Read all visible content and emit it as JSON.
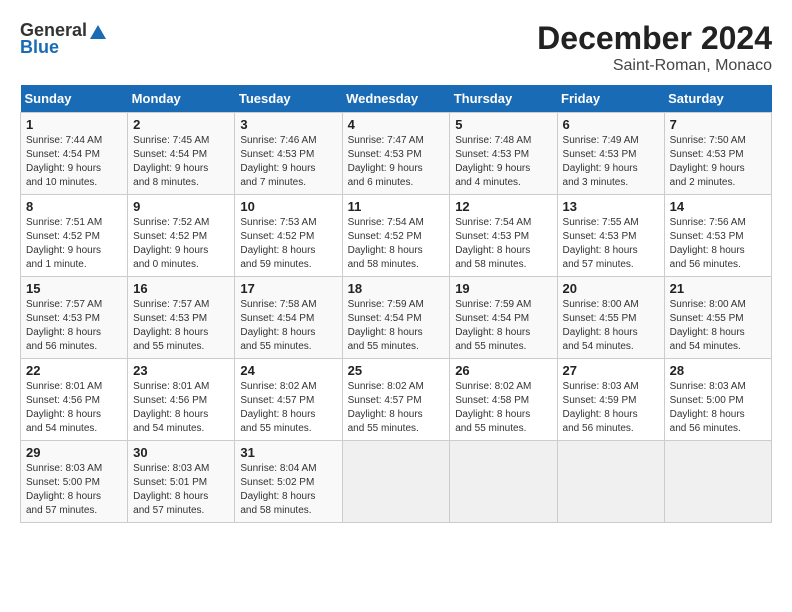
{
  "header": {
    "logo_general": "General",
    "logo_blue": "Blue",
    "month": "December 2024",
    "location": "Saint-Roman, Monaco"
  },
  "weekdays": [
    "Sunday",
    "Monday",
    "Tuesday",
    "Wednesday",
    "Thursday",
    "Friday",
    "Saturday"
  ],
  "weeks": [
    [
      {
        "day": "1",
        "info": "Sunrise: 7:44 AM\nSunset: 4:54 PM\nDaylight: 9 hours\nand 10 minutes."
      },
      {
        "day": "2",
        "info": "Sunrise: 7:45 AM\nSunset: 4:54 PM\nDaylight: 9 hours\nand 8 minutes."
      },
      {
        "day": "3",
        "info": "Sunrise: 7:46 AM\nSunset: 4:53 PM\nDaylight: 9 hours\nand 7 minutes."
      },
      {
        "day": "4",
        "info": "Sunrise: 7:47 AM\nSunset: 4:53 PM\nDaylight: 9 hours\nand 6 minutes."
      },
      {
        "day": "5",
        "info": "Sunrise: 7:48 AM\nSunset: 4:53 PM\nDaylight: 9 hours\nand 4 minutes."
      },
      {
        "day": "6",
        "info": "Sunrise: 7:49 AM\nSunset: 4:53 PM\nDaylight: 9 hours\nand 3 minutes."
      },
      {
        "day": "7",
        "info": "Sunrise: 7:50 AM\nSunset: 4:53 PM\nDaylight: 9 hours\nand 2 minutes."
      }
    ],
    [
      {
        "day": "8",
        "info": "Sunrise: 7:51 AM\nSunset: 4:52 PM\nDaylight: 9 hours\nand 1 minute."
      },
      {
        "day": "9",
        "info": "Sunrise: 7:52 AM\nSunset: 4:52 PM\nDaylight: 9 hours\nand 0 minutes."
      },
      {
        "day": "10",
        "info": "Sunrise: 7:53 AM\nSunset: 4:52 PM\nDaylight: 8 hours\nand 59 minutes."
      },
      {
        "day": "11",
        "info": "Sunrise: 7:54 AM\nSunset: 4:52 PM\nDaylight: 8 hours\nand 58 minutes."
      },
      {
        "day": "12",
        "info": "Sunrise: 7:54 AM\nSunset: 4:53 PM\nDaylight: 8 hours\nand 58 minutes."
      },
      {
        "day": "13",
        "info": "Sunrise: 7:55 AM\nSunset: 4:53 PM\nDaylight: 8 hours\nand 57 minutes."
      },
      {
        "day": "14",
        "info": "Sunrise: 7:56 AM\nSunset: 4:53 PM\nDaylight: 8 hours\nand 56 minutes."
      }
    ],
    [
      {
        "day": "15",
        "info": "Sunrise: 7:57 AM\nSunset: 4:53 PM\nDaylight: 8 hours\nand 56 minutes."
      },
      {
        "day": "16",
        "info": "Sunrise: 7:57 AM\nSunset: 4:53 PM\nDaylight: 8 hours\nand 55 minutes."
      },
      {
        "day": "17",
        "info": "Sunrise: 7:58 AM\nSunset: 4:54 PM\nDaylight: 8 hours\nand 55 minutes."
      },
      {
        "day": "18",
        "info": "Sunrise: 7:59 AM\nSunset: 4:54 PM\nDaylight: 8 hours\nand 55 minutes."
      },
      {
        "day": "19",
        "info": "Sunrise: 7:59 AM\nSunset: 4:54 PM\nDaylight: 8 hours\nand 55 minutes."
      },
      {
        "day": "20",
        "info": "Sunrise: 8:00 AM\nSunset: 4:55 PM\nDaylight: 8 hours\nand 54 minutes."
      },
      {
        "day": "21",
        "info": "Sunrise: 8:00 AM\nSunset: 4:55 PM\nDaylight: 8 hours\nand 54 minutes."
      }
    ],
    [
      {
        "day": "22",
        "info": "Sunrise: 8:01 AM\nSunset: 4:56 PM\nDaylight: 8 hours\nand 54 minutes."
      },
      {
        "day": "23",
        "info": "Sunrise: 8:01 AM\nSunset: 4:56 PM\nDaylight: 8 hours\nand 54 minutes."
      },
      {
        "day": "24",
        "info": "Sunrise: 8:02 AM\nSunset: 4:57 PM\nDaylight: 8 hours\nand 55 minutes."
      },
      {
        "day": "25",
        "info": "Sunrise: 8:02 AM\nSunset: 4:57 PM\nDaylight: 8 hours\nand 55 minutes."
      },
      {
        "day": "26",
        "info": "Sunrise: 8:02 AM\nSunset: 4:58 PM\nDaylight: 8 hours\nand 55 minutes."
      },
      {
        "day": "27",
        "info": "Sunrise: 8:03 AM\nSunset: 4:59 PM\nDaylight: 8 hours\nand 56 minutes."
      },
      {
        "day": "28",
        "info": "Sunrise: 8:03 AM\nSunset: 5:00 PM\nDaylight: 8 hours\nand 56 minutes."
      }
    ],
    [
      {
        "day": "29",
        "info": "Sunrise: 8:03 AM\nSunset: 5:00 PM\nDaylight: 8 hours\nand 57 minutes."
      },
      {
        "day": "30",
        "info": "Sunrise: 8:03 AM\nSunset: 5:01 PM\nDaylight: 8 hours\nand 57 minutes."
      },
      {
        "day": "31",
        "info": "Sunrise: 8:04 AM\nSunset: 5:02 PM\nDaylight: 8 hours\nand 58 minutes."
      },
      {
        "day": "",
        "info": ""
      },
      {
        "day": "",
        "info": ""
      },
      {
        "day": "",
        "info": ""
      },
      {
        "day": "",
        "info": ""
      }
    ]
  ]
}
